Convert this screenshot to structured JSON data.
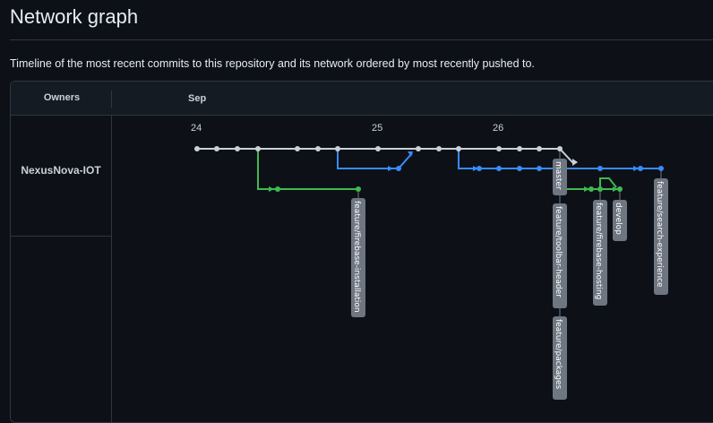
{
  "page": {
    "title": "Network graph",
    "description": "Timeline of the most recent commits to this repository and its network ordered by most recently pushed to."
  },
  "graph": {
    "owners_label": "Owners",
    "month": "Sep",
    "days": [
      "24",
      "25",
      "26"
    ],
    "owner": "NexusNova-IOT",
    "colors": {
      "main": "#c9d1d9",
      "blue": "#388bfd",
      "green": "#3fb950",
      "tag": "#6e7681"
    },
    "branches": [
      "master",
      "feature/firebase-installation",
      "feature/toolbar-header",
      "feature/packages",
      "feature/firebase-hosting",
      "develop",
      "feature/search-experience"
    ]
  }
}
